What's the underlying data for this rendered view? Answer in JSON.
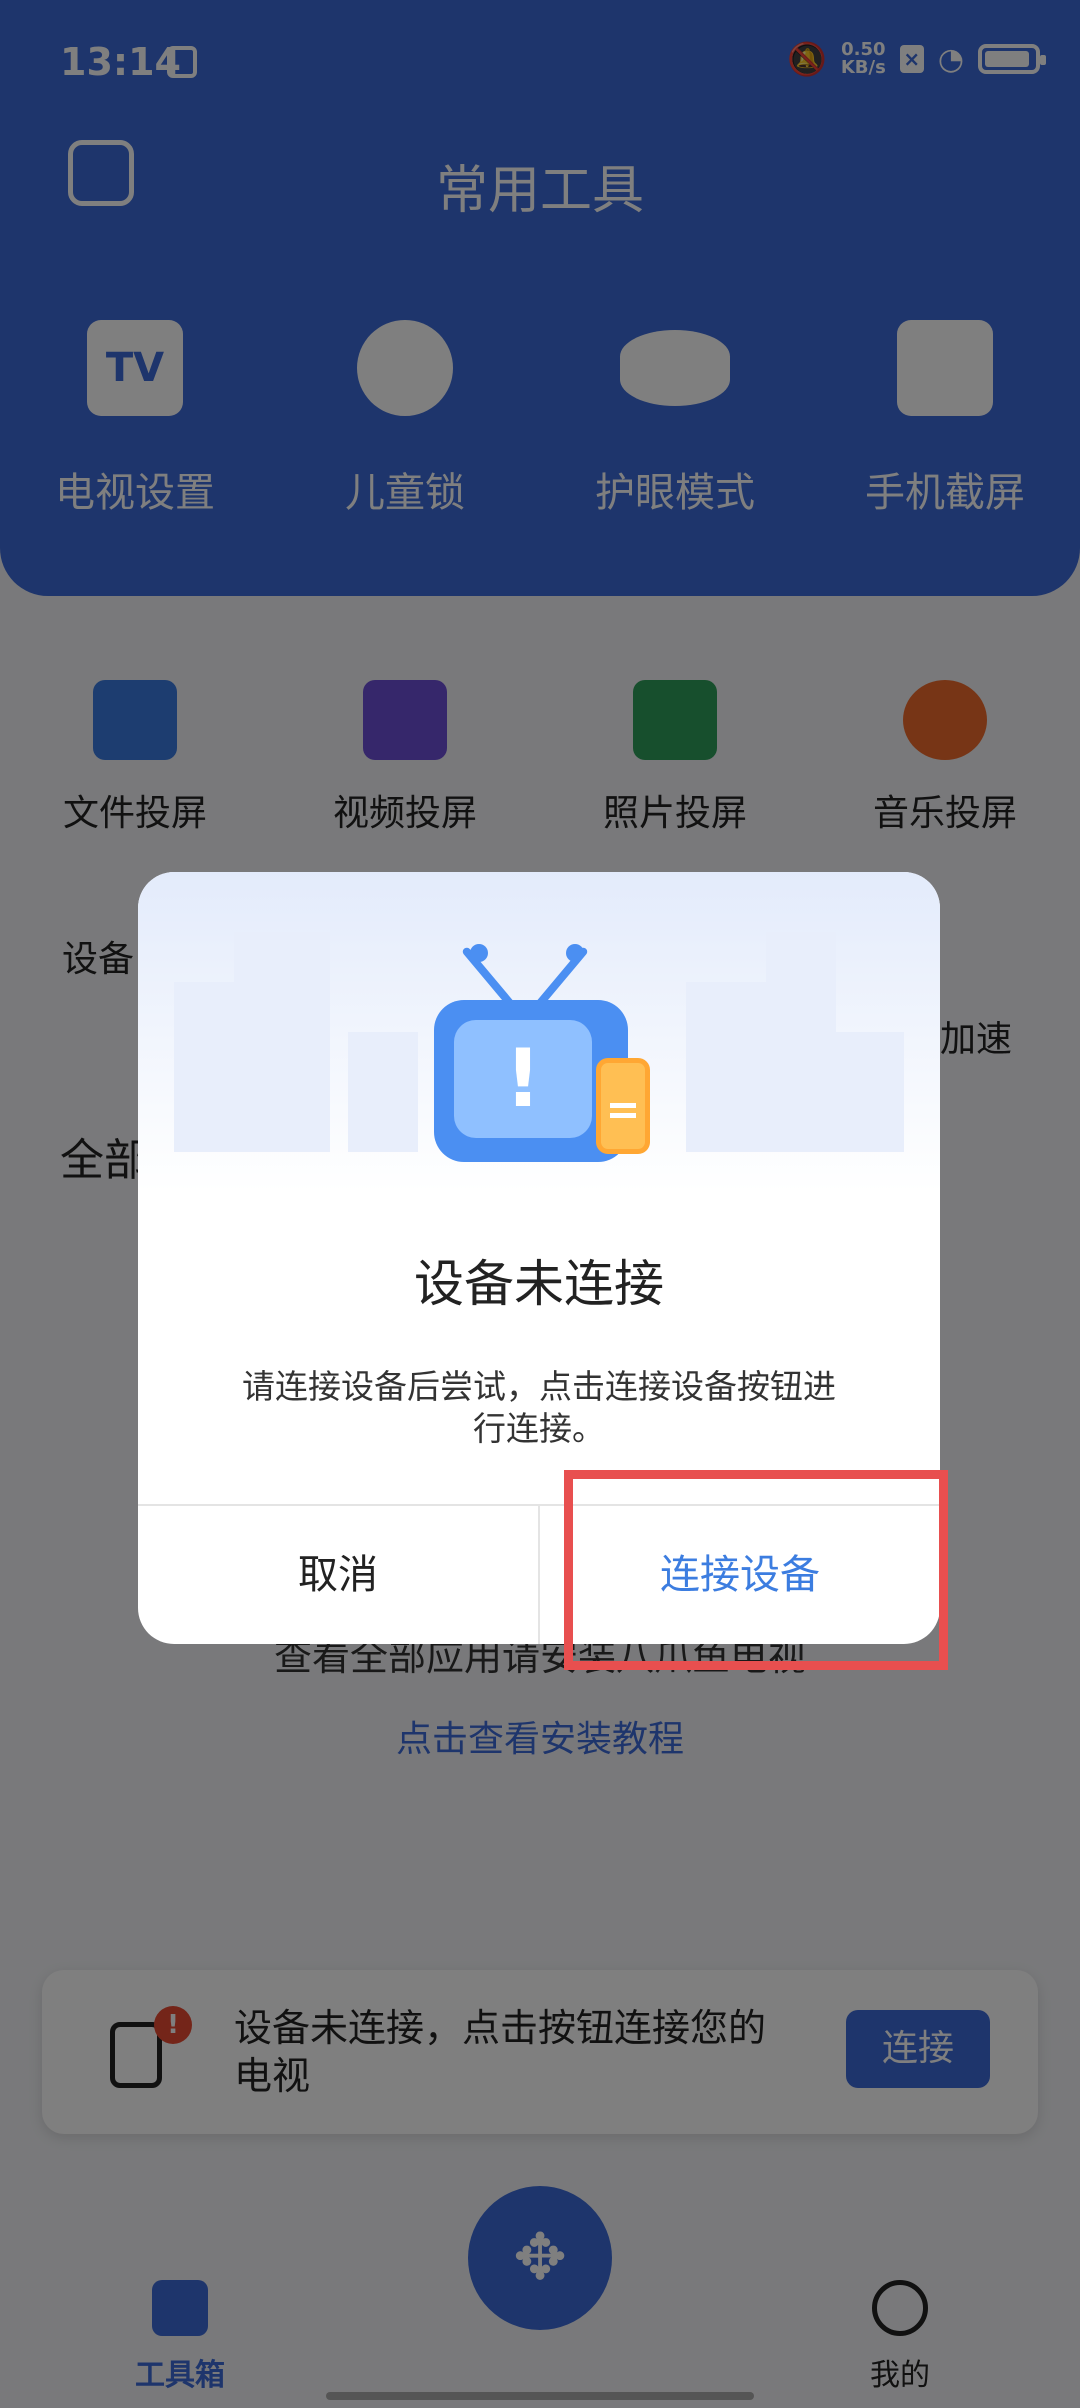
{
  "status_bar": {
    "time": "13:14",
    "net_speed_value": "0.50",
    "net_speed_unit": "KB/s"
  },
  "header": {
    "title": "常用工具",
    "tools": [
      {
        "label": "电视设置",
        "icon": "tv-settings-icon",
        "glyph": "TV"
      },
      {
        "label": "儿童锁",
        "icon": "child-lock-icon",
        "glyph": ""
      },
      {
        "label": "护眼模式",
        "icon": "eye-protection-icon",
        "glyph": ""
      },
      {
        "label": "手机截屏",
        "icon": "screenshot-icon",
        "glyph": ""
      }
    ]
  },
  "grid_tools": [
    {
      "label": "文件投屏",
      "icon": "file-folder-icon",
      "color": "#3a7be0"
    },
    {
      "label": "视频投屏",
      "icon": "video-icon",
      "color": "#6d4fd6"
    },
    {
      "label": "照片投屏",
      "icon": "photo-icon",
      "color": "#2f9e5a"
    },
    {
      "label": "音乐投屏",
      "icon": "music-icon",
      "color": "#ee6a2c"
    }
  ],
  "row2": {
    "left_label_fragment": "设备",
    "right_label_fragment": "加速"
  },
  "all_apps_fragment": "全部",
  "install_notice": "查看全部应用请安装八爪鱼电视",
  "install_link": "点击查看安装教程",
  "connect_card": {
    "message": "设备未连接，点击按钮连接您的电视",
    "button_label": "连接",
    "badge": "!"
  },
  "dialog": {
    "title": "设备未连接",
    "message": "请连接设备后尝试，点击连接设备按钮进行连接。",
    "cancel_label": "取消",
    "confirm_label": "连接设备",
    "tv_glyph": "!"
  },
  "bottom_nav": {
    "tools_label": "工具箱",
    "mine_label": "我的",
    "fab_glyph": "✥"
  },
  "colors": {
    "primary": "#3c6ad8",
    "highlight": "#e84f4f",
    "badge": "#e84a33",
    "link": "#3c7de0"
  }
}
